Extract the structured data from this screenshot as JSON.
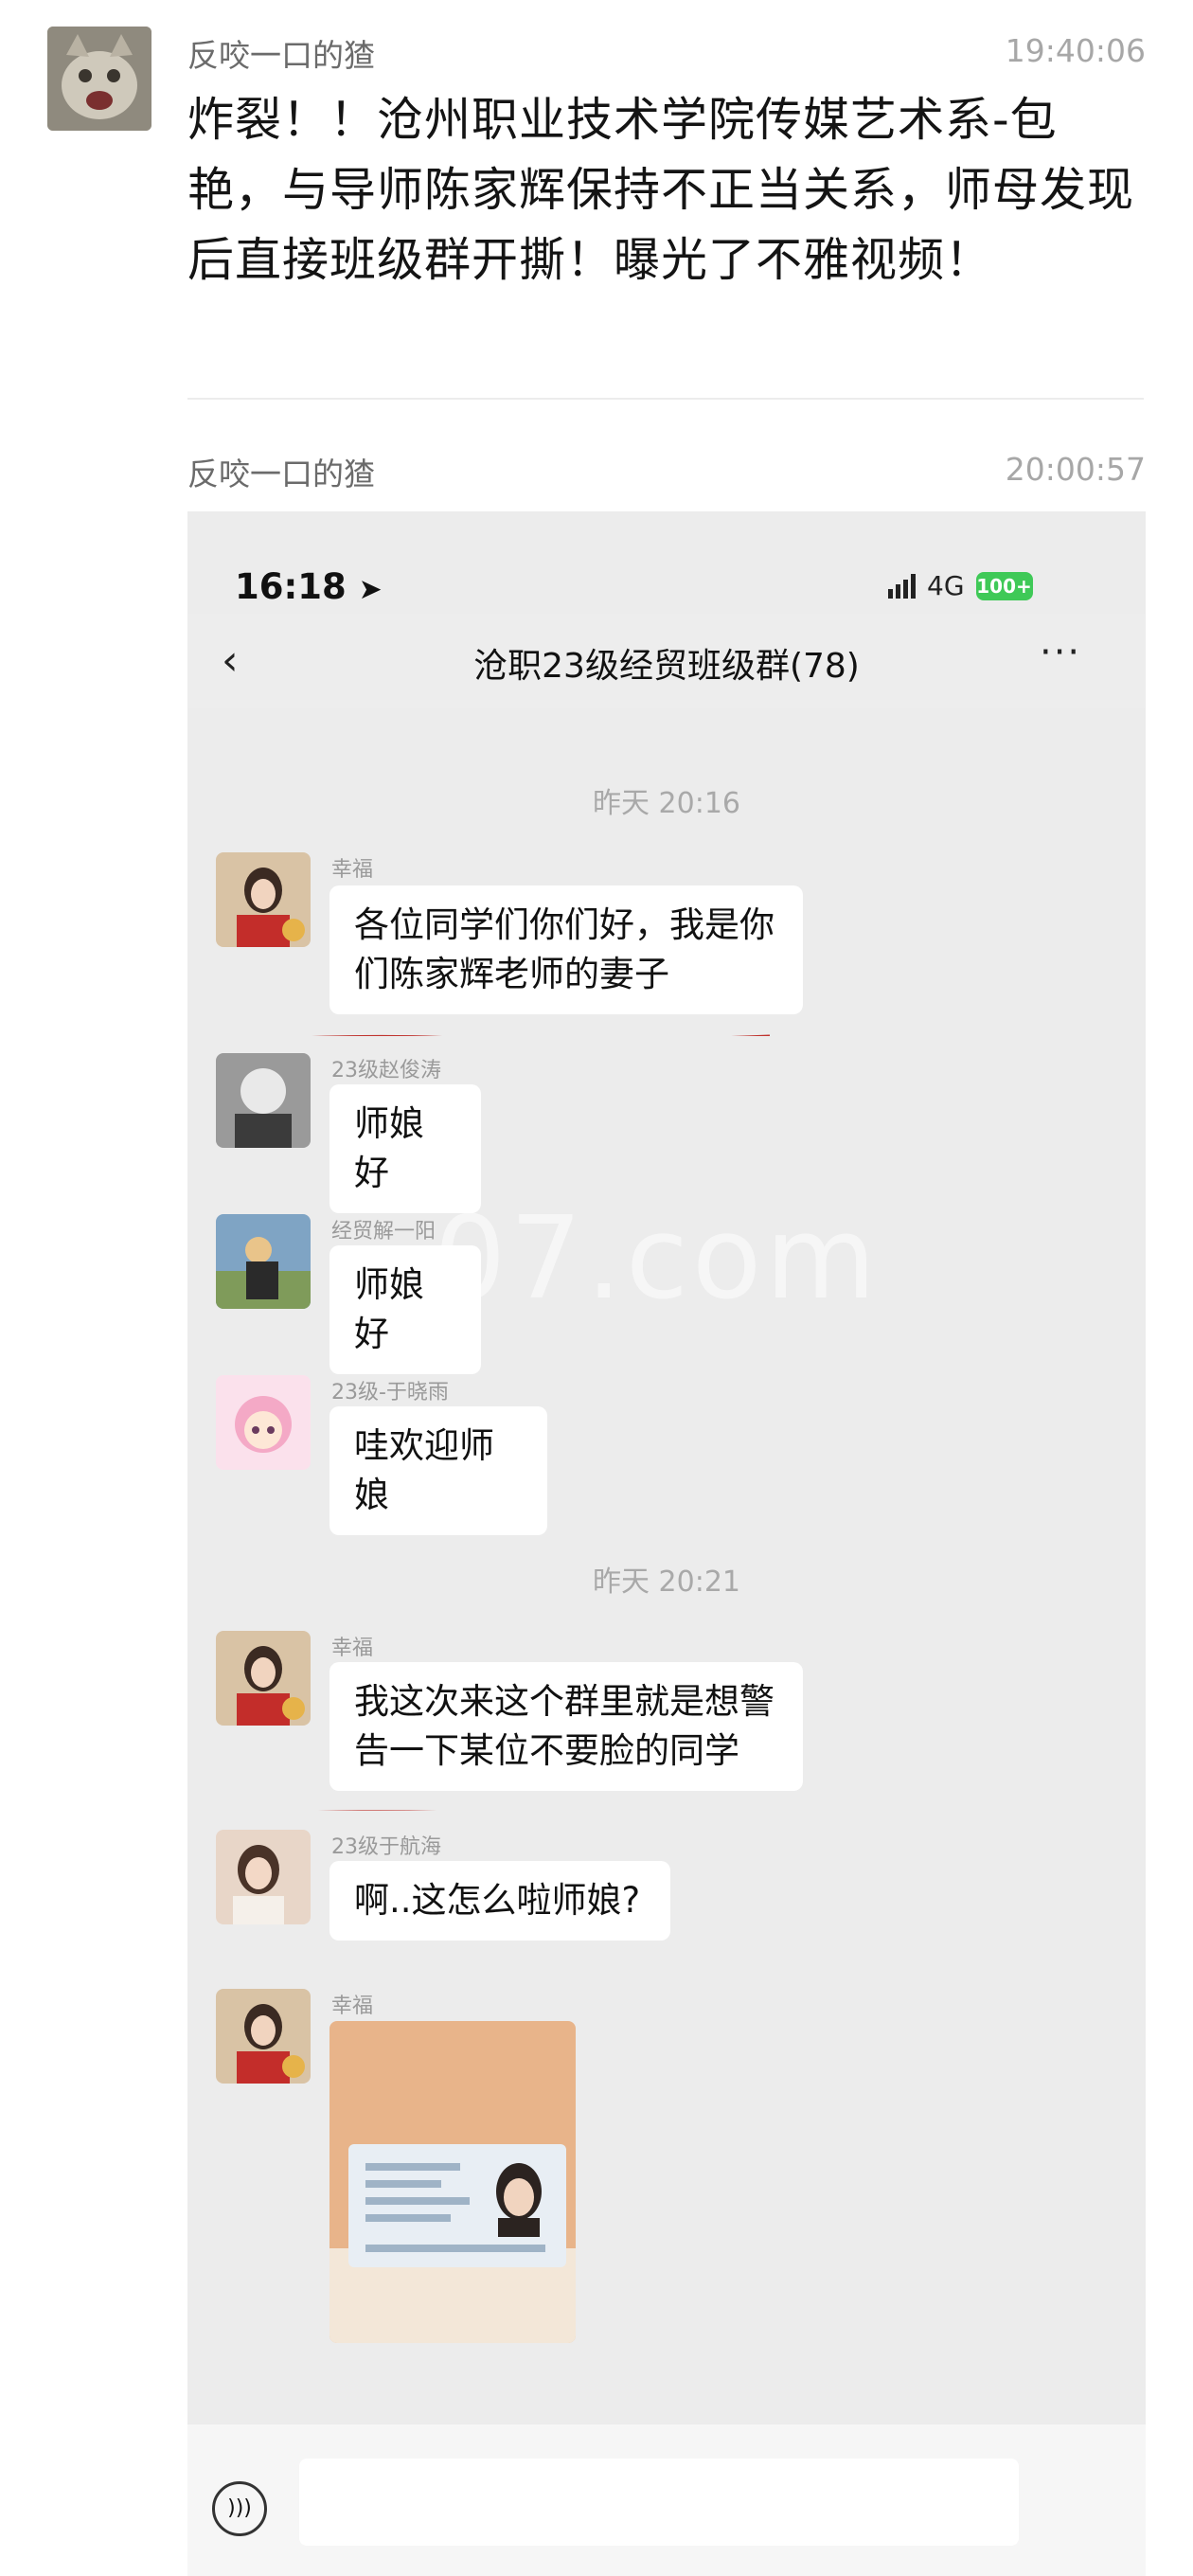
{
  "feed": {
    "post1": {
      "poster": "反咬一口的猹",
      "time": "19:40:06",
      "text": "炸裂！！沧州职业技术学院传媒艺术系-包艳，与导师陈家辉保持不正当关系，师母发现后直接班级群开撕！曝光了不雅视频！"
    },
    "post2": {
      "poster": "反咬一口的猹",
      "time": "20:00:57"
    }
  },
  "phone": {
    "status_time": "16:18",
    "network": "4G",
    "battery": "100+",
    "chat_title": "沧职23级经贸班级群(78)",
    "watermark": "07.com",
    "timestamps": [
      "昨天 20:16",
      "昨天 20:21"
    ],
    "messages": [
      {
        "sender": "幸福",
        "text": "各位同学们你们好，我是你们陈家辉老师的妻子"
      },
      {
        "sender": "23级赵俊涛",
        "text": "师娘好"
      },
      {
        "sender": "经贸解一阳",
        "text": "师娘好"
      },
      {
        "sender": "23级-于晓雨",
        "text": "哇欢迎师娘"
      },
      {
        "sender": "幸福",
        "text": "我这次来这个群里就是想警告一下某位不要脸的同学"
      },
      {
        "sender": "23级于航海",
        "text": "啊..这怎么啦师娘?"
      },
      {
        "sender": "幸福",
        "text": ""
      }
    ]
  },
  "colors": {
    "chat_bg": "#ececec",
    "bubble": "#ffffff",
    "underline": "#c0342f",
    "battery": "#3fc957"
  }
}
